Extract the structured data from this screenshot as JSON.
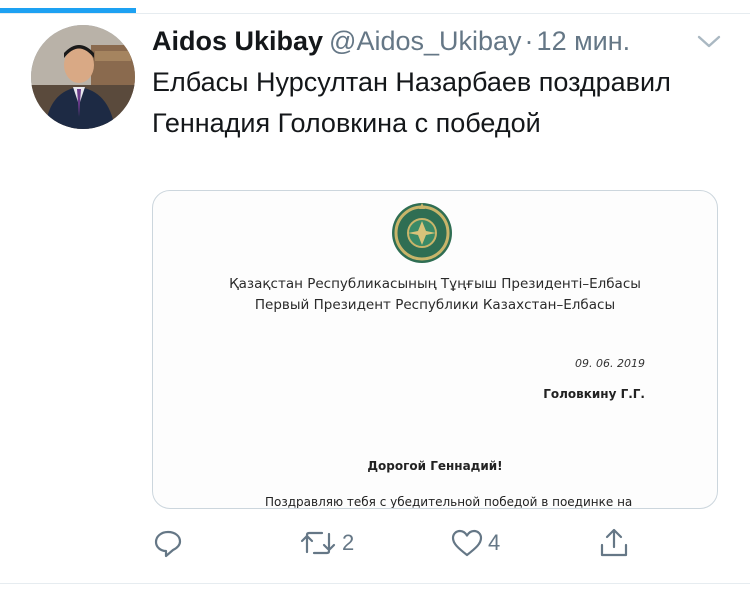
{
  "tweet": {
    "author_name": "Aidos Ukibay",
    "author_handle": "@Aidos_Ukibay",
    "separator": "·",
    "time": "12 мин.",
    "text": "Елбасы Нурсултан Назарбаев поздравил Геннадия Головкина с победой"
  },
  "media": {
    "doc_line1": "Қазақстан Республикасының Тұңғыш Президенті–Елбасы",
    "doc_line2": "Первый Президент Республики Казахстан–Елбасы",
    "date": "09. 06. 2019",
    "recipient": "Головкину Г.Г.",
    "greeting": "Дорогой Геннадий!",
    "body_start": "Поздравляю тебя с убедительной победой в поединке на"
  },
  "actions": {
    "reply_count": "",
    "retweet_count": "2",
    "like_count": "4"
  },
  "icons": {
    "reply": "reply-icon",
    "retweet": "retweet-icon",
    "like": "heart-icon",
    "share": "share-icon",
    "menu": "chevron-down-icon"
  },
  "colors": {
    "accent": "#1da1f2",
    "muted": "#657786",
    "text": "#14171a",
    "border": "#ccd6dd"
  }
}
